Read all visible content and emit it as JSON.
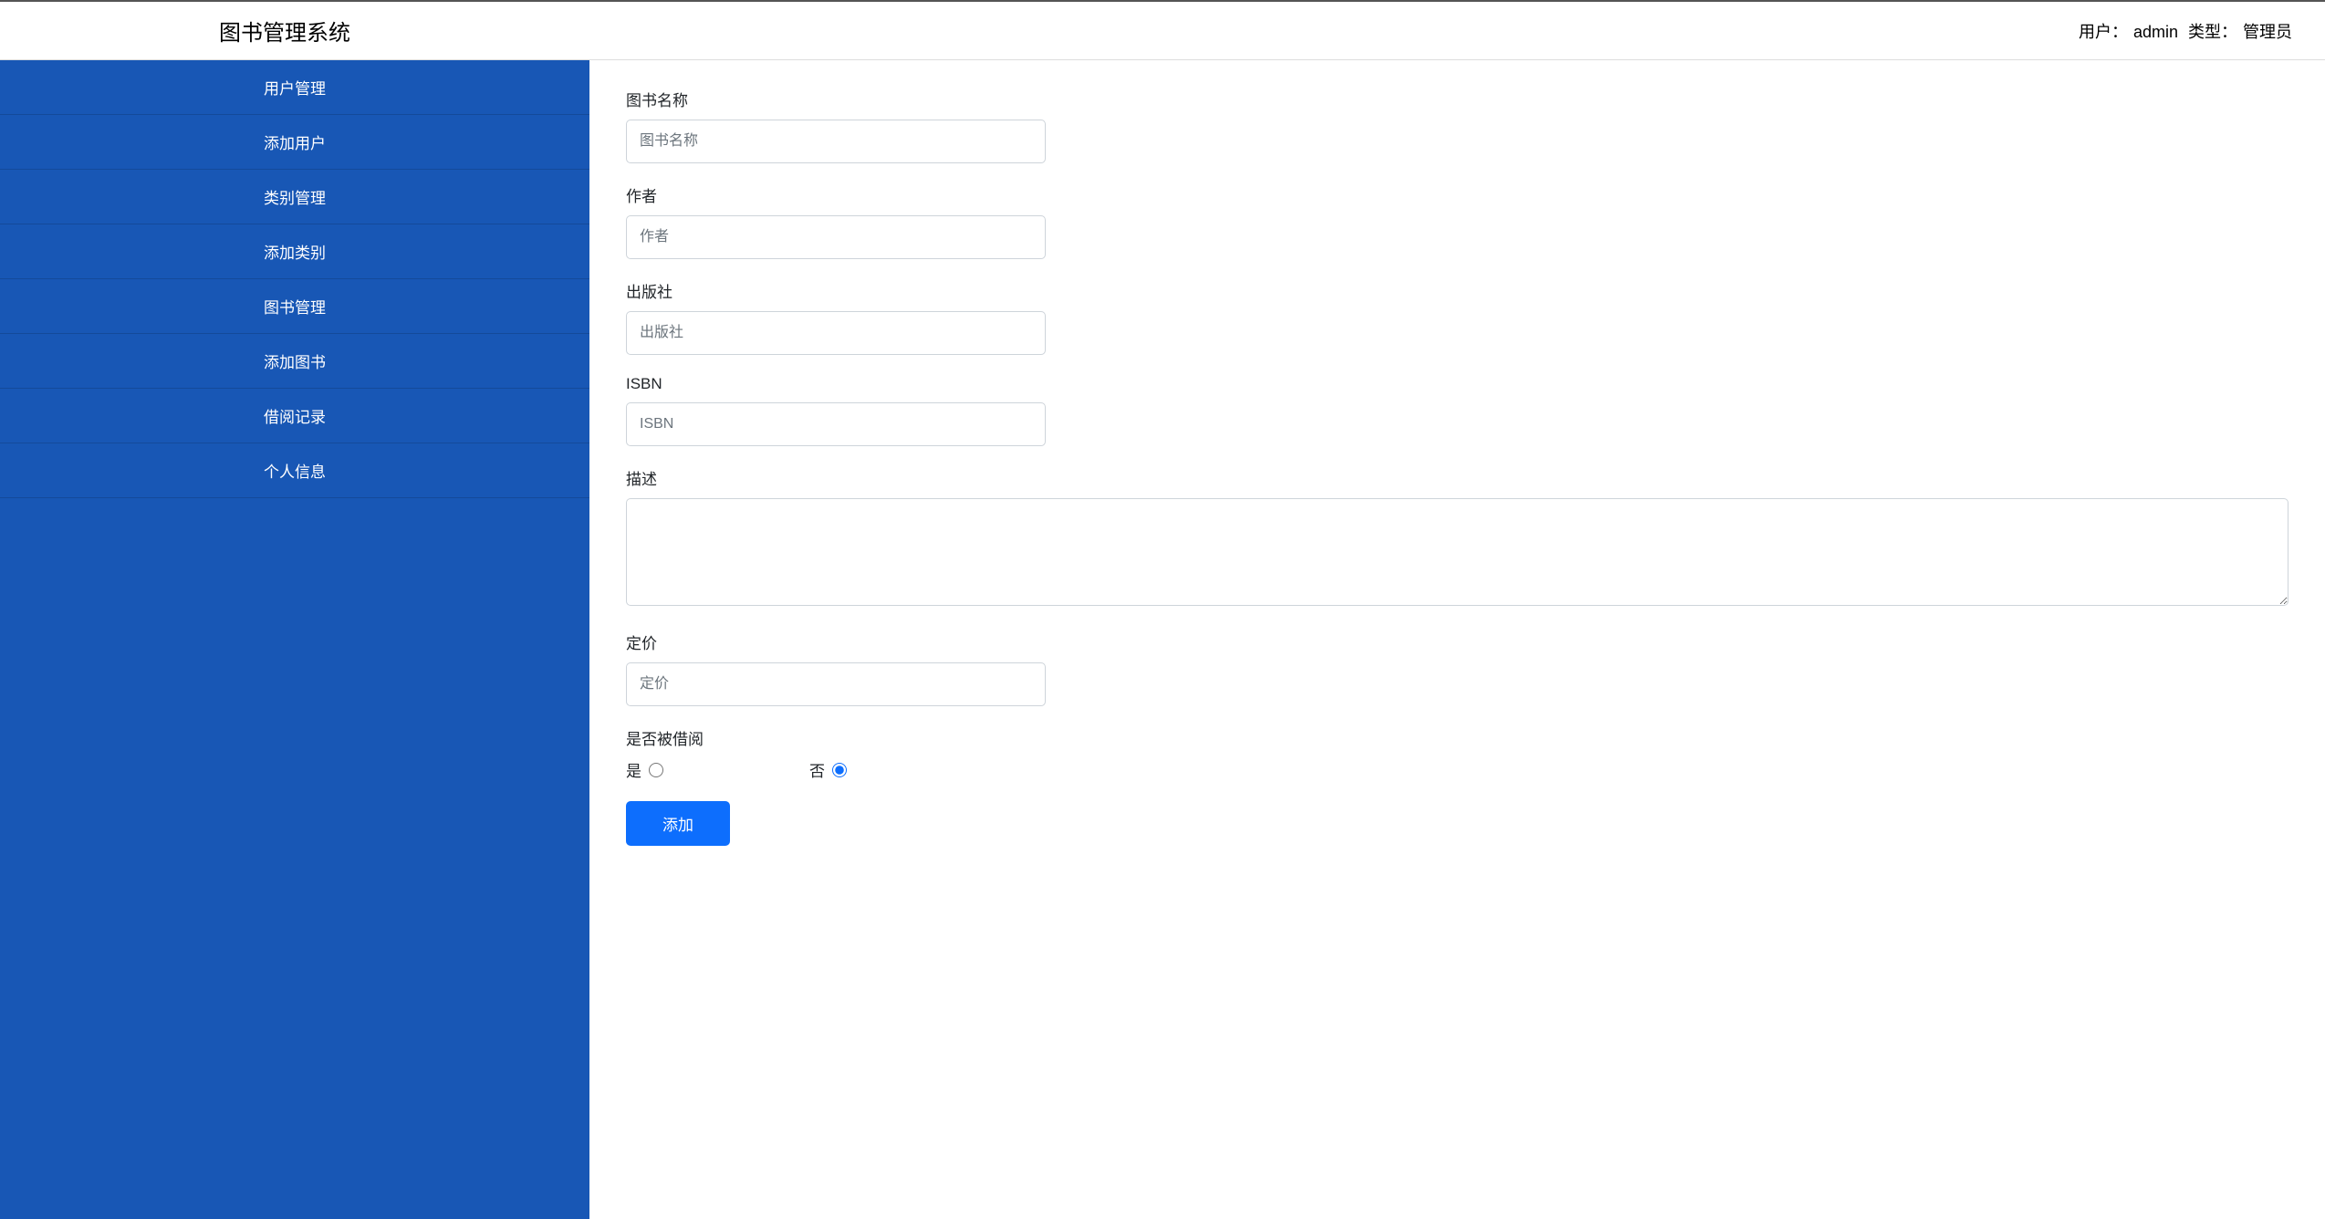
{
  "header": {
    "title": "图书管理系统",
    "user_label": "用户：",
    "user_value": "admin",
    "type_label": "类型：",
    "type_value": "管理员"
  },
  "sidebar": {
    "items": [
      {
        "label": "用户管理"
      },
      {
        "label": "添加用户"
      },
      {
        "label": "类别管理"
      },
      {
        "label": "添加类别"
      },
      {
        "label": "图书管理"
      },
      {
        "label": "添加图书"
      },
      {
        "label": "借阅记录"
      },
      {
        "label": "个人信息"
      }
    ]
  },
  "form": {
    "book_name_label": "图书名称",
    "book_name_placeholder": "图书名称",
    "author_label": "作者",
    "author_placeholder": "作者",
    "publisher_label": "出版社",
    "publisher_placeholder": "出版社",
    "isbn_label": "ISBN",
    "isbn_placeholder": "ISBN",
    "description_label": "描述",
    "price_label": "定价",
    "price_placeholder": "定价",
    "borrowed_label": "是否被借阅",
    "borrowed_yes": "是",
    "borrowed_no": "否",
    "submit_label": "添加"
  }
}
